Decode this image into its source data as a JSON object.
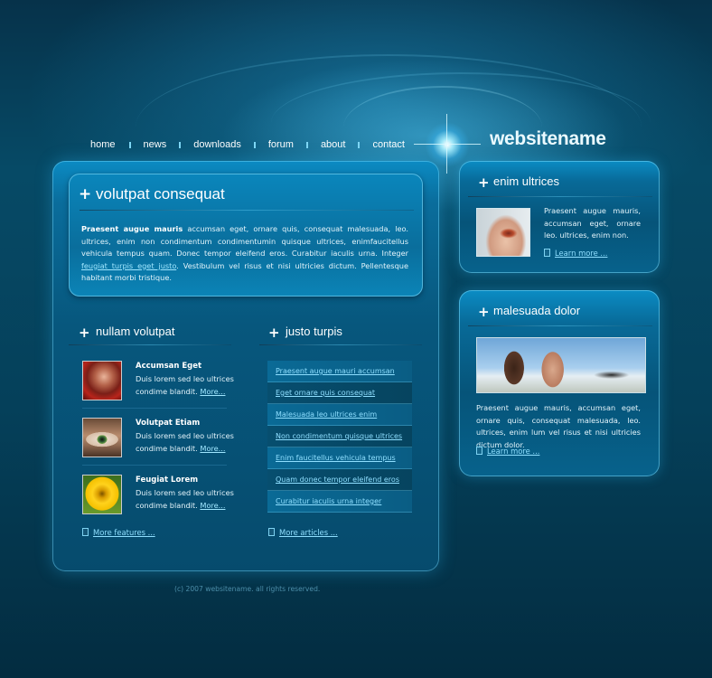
{
  "brand": {
    "name": "websitename"
  },
  "nav": {
    "items": [
      {
        "label": "home"
      },
      {
        "label": "news"
      },
      {
        "label": "downloads"
      },
      {
        "label": "forum"
      },
      {
        "label": "about"
      },
      {
        "label": "contact"
      }
    ]
  },
  "main": {
    "title": "volutpat consequat",
    "intro": {
      "lead": "Praesent augue mauris",
      "text_before_link": " accumsan eget, ornare quis, consequat malesuada, leo. ultrices, enim non condimentum condimentumin quisque ultrices, enimfaucitellus vehicula tempus quam. Donec tempor eleifend eros. Curabitur iaculis urna. Integer ",
      "link": "feugiat turpis eget justo",
      "text_after_link": ". Vestibulum vel risus et nisi ultricies dictum. Pellentesque habitant morbi tristique."
    },
    "features": {
      "title": "nullam volutpat",
      "items": [
        {
          "title": "Accumsan Eget",
          "text": "Duis lorem sed leo ultrices condime blandit.",
          "more": "More..."
        },
        {
          "title": "Volutpat Etiam",
          "text": "Duis lorem sed leo ultrices condime blandit.",
          "more": "More..."
        },
        {
          "title": "Feugiat Lorem",
          "text": "Duis lorem sed leo ultrices condime blandit.",
          "more": "More..."
        }
      ],
      "more_link": "More features ..."
    },
    "articles": {
      "title": "justo turpis",
      "items": [
        "Praesent augue mauri  accumsan",
        "Eget ornare quis consequat",
        "Malesuada leo ultrices enim",
        "Non condimentum quisque ultrices",
        "Enim faucitellus vehicula tempus",
        "Quam donec tempor eleifend eros",
        "Curabitur iaculis urna integer"
      ],
      "more_link": "More articles ..."
    }
  },
  "sidebar": {
    "box1": {
      "title": "enim ultrices",
      "text": "Praesent augue mauris, accumsan eget, ornare leo. ultrices, enim non.",
      "more": "Learn more ..."
    },
    "box2": {
      "title": "malesuada dolor",
      "text": "Praesent augue mauris, accumsan eget, ornare quis, consequat malesuada, leo. ultrices, enim lum vel risus et nisi ultricies dictum dolor.",
      "more": "Learn more ..."
    }
  },
  "footer": {
    "copyright": "(c) 2007 websitename. all rights reserved."
  },
  "colors": {
    "background": "#064a66",
    "accent": "#0a8bc3",
    "link": "#8fdfff",
    "text": "#e3f4fb"
  }
}
